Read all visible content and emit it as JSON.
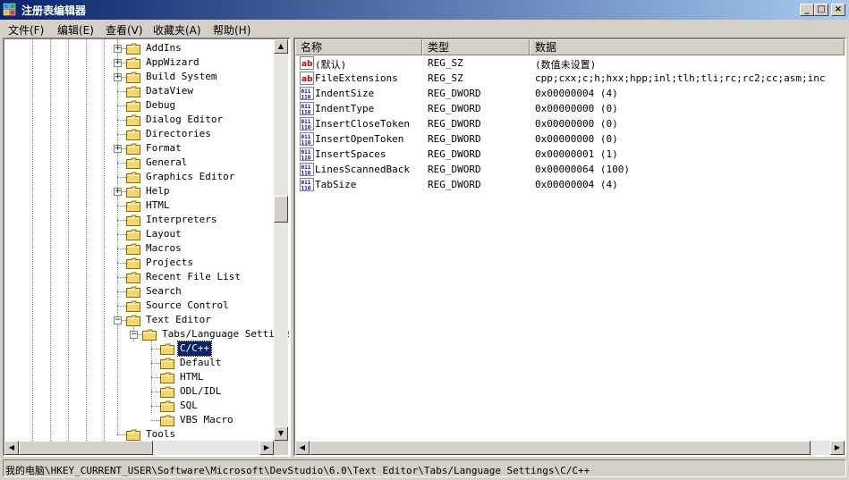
{
  "window": {
    "title": "注册表编辑器",
    "minimize_glyph": "_",
    "maximize_glyph": "□",
    "close_glyph": "×"
  },
  "menu": [
    "文件(F)",
    "编辑(E)",
    "查看(V)",
    "收藏夹(A)",
    "帮助(H)"
  ],
  "tree": {
    "items": [
      {
        "label": "AddIns",
        "level": 0,
        "expander": "+"
      },
      {
        "label": "AppWizard",
        "level": 0,
        "expander": "+"
      },
      {
        "label": "Build System",
        "level": 0,
        "expander": "+"
      },
      {
        "label": "DataView",
        "level": 0,
        "expander": ""
      },
      {
        "label": "Debug",
        "level": 0,
        "expander": ""
      },
      {
        "label": "Dialog Editor",
        "level": 0,
        "expander": ""
      },
      {
        "label": "Directories",
        "level": 0,
        "expander": ""
      },
      {
        "label": "Format",
        "level": 0,
        "expander": "+"
      },
      {
        "label": "General",
        "level": 0,
        "expander": ""
      },
      {
        "label": "Graphics Editor",
        "level": 0,
        "expander": ""
      },
      {
        "label": "Help",
        "level": 0,
        "expander": "+"
      },
      {
        "label": "HTML",
        "level": 0,
        "expander": ""
      },
      {
        "label": "Interpreters",
        "level": 0,
        "expander": ""
      },
      {
        "label": "Layout",
        "level": 0,
        "expander": ""
      },
      {
        "label": "Macros",
        "level": 0,
        "expander": ""
      },
      {
        "label": "Projects",
        "level": 0,
        "expander": ""
      },
      {
        "label": "Recent File List",
        "level": 0,
        "expander": ""
      },
      {
        "label": "Search",
        "level": 0,
        "expander": ""
      },
      {
        "label": "Source Control",
        "level": 0,
        "expander": ""
      },
      {
        "label": "Text Editor",
        "level": 0,
        "expander": "−"
      },
      {
        "label": "Tabs/Language Settings",
        "level": 1,
        "expander": "−"
      },
      {
        "label": "C/C++",
        "level": 2,
        "expander": "",
        "selected": true
      },
      {
        "label": "Default",
        "level": 2,
        "expander": ""
      },
      {
        "label": "HTML",
        "level": 2,
        "expander": ""
      },
      {
        "label": "ODL/IDL",
        "level": 2,
        "expander": ""
      },
      {
        "label": "SQL",
        "level": 2,
        "expander": ""
      },
      {
        "label": "VBS Macro",
        "level": 2,
        "expander": ""
      },
      {
        "label": "Tools",
        "level": 0,
        "expander": ""
      }
    ]
  },
  "list": {
    "columns": [
      "名称",
      "类型",
      "数据"
    ],
    "rows": [
      {
        "name": "(默认)",
        "type": "REG_SZ",
        "data": "(数值未设置)",
        "icon": "string-value-icon"
      },
      {
        "name": "FileExtensions",
        "type": "REG_SZ",
        "data": "cpp;cxx;c;h;hxx;hpp;inl;tlh;tli;rc;rc2;cc;asm;inc",
        "icon": "string-value-icon"
      },
      {
        "name": "IndentSize",
        "type": "REG_DWORD",
        "data": "0x00000004 (4)",
        "icon": "binary-value-icon"
      },
      {
        "name": "IndentType",
        "type": "REG_DWORD",
        "data": "0x00000000 (0)",
        "icon": "binary-value-icon"
      },
      {
        "name": "InsertCloseToken",
        "type": "REG_DWORD",
        "data": "0x00000000 (0)",
        "icon": "binary-value-icon"
      },
      {
        "name": "InsertOpenToken",
        "type": "REG_DWORD",
        "data": "0x00000000 (0)",
        "icon": "binary-value-icon"
      },
      {
        "name": "InsertSpaces",
        "type": "REG_DWORD",
        "data": "0x00000001 (1)",
        "icon": "binary-value-icon"
      },
      {
        "name": "LinesScannedBack",
        "type": "REG_DWORD",
        "data": "0x00000064 (100)",
        "icon": "binary-value-icon"
      },
      {
        "name": "TabSize",
        "type": "REG_DWORD",
        "data": "0x00000004 (4)",
        "icon": "binary-value-icon"
      }
    ]
  },
  "scroll": {
    "up": "▲",
    "down": "▼",
    "left": "◀",
    "right": "▶"
  },
  "status": {
    "path": "我的电脑\\HKEY_CURRENT_USER\\Software\\Microsoft\\DevStudio\\6.0\\Text Editor\\Tabs/Language Settings\\C/C++"
  },
  "colors": {
    "titlebar": "#0a246a",
    "selection": "#0a246a",
    "folder": "#f5d76e",
    "chrome": "#d4d0c8"
  }
}
